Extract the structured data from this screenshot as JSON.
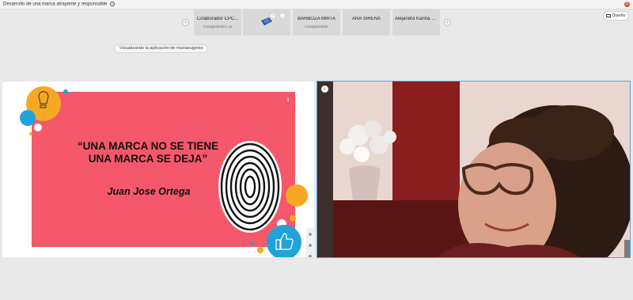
{
  "meeting": {
    "title": "Desarrollo de una marca atrayente y responsable",
    "info_icon": "i",
    "notification_count": "0"
  },
  "participants": [
    {
      "name": "Colaborador CPC...",
      "role": "Coorganizador, yo"
    },
    {
      "name": "",
      "role": "",
      "icon": "shared-screen-thumbnail"
    },
    {
      "name": "BARBOZA MIRTA",
      "role": "Coorganizador"
    },
    {
      "name": "ANA SIRENA",
      "role": ""
    },
    {
      "name": "Alejandra Karina D...",
      "role": ""
    }
  ],
  "strip": {
    "prev": "‹",
    "next": "›"
  },
  "layout_button": {
    "label": "Diseño",
    "icon": "layout-icon"
  },
  "viewing_label": "Visualizando la aplicación de mariaeugenia",
  "slide": {
    "number": "3",
    "quote_line1": "“UNA MARCA NO SE TIENE",
    "quote_line2": "UNA MARCA SE DEJA”",
    "author": "Juan Jose Ortega",
    "accent_color": "#f4586a"
  },
  "video": {
    "badge_icon": "chevron-down-icon"
  }
}
